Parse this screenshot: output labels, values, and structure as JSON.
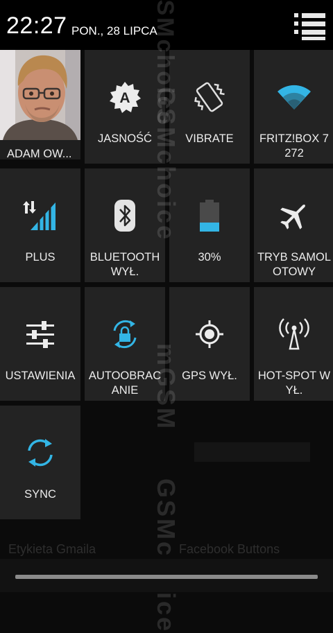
{
  "status_bar": {
    "time": "22:27",
    "date": "PON., 28 LIPCA"
  },
  "profile": {
    "name": "ADAM OW..."
  },
  "tiles": [
    {
      "label": "JASNOŚĆ",
      "icon": "brightness-auto-icon"
    },
    {
      "label": "VIBRATE",
      "icon": "vibrate-icon"
    },
    {
      "label": "FRITZ!BOX 7272",
      "icon": "wifi-icon"
    },
    {
      "label": "PLUS",
      "icon": "mobile-signal-icon"
    },
    {
      "label": "BLUETOOTH WYŁ.",
      "icon": "bluetooth-icon"
    },
    {
      "label": "30%",
      "icon": "battery-icon",
      "level": 0.3
    },
    {
      "label": "TRYB SAMOLOTOWY",
      "icon": "airplane-icon"
    },
    {
      "label": "USTAWIENIA",
      "icon": "settings-sliders-icon"
    },
    {
      "label": "AUTOOBRACANIE",
      "icon": "auto-rotate-icon"
    },
    {
      "label": "GPS WYŁ.",
      "icon": "gps-icon"
    },
    {
      "label": "HOT-SPOT WYŁ.",
      "icon": "hotspot-icon"
    },
    {
      "label": "SYNC",
      "icon": "sync-icon"
    }
  ],
  "background": {
    "left_label": "Etykieta Gmaila",
    "right_label": "Facebook Buttons"
  },
  "watermarks": {
    "primary": "GSMchoice",
    "secondary": "mGSM"
  },
  "colors": {
    "accent": "#33b5e5",
    "tile": "#232323",
    "statusbar": "#000000"
  }
}
